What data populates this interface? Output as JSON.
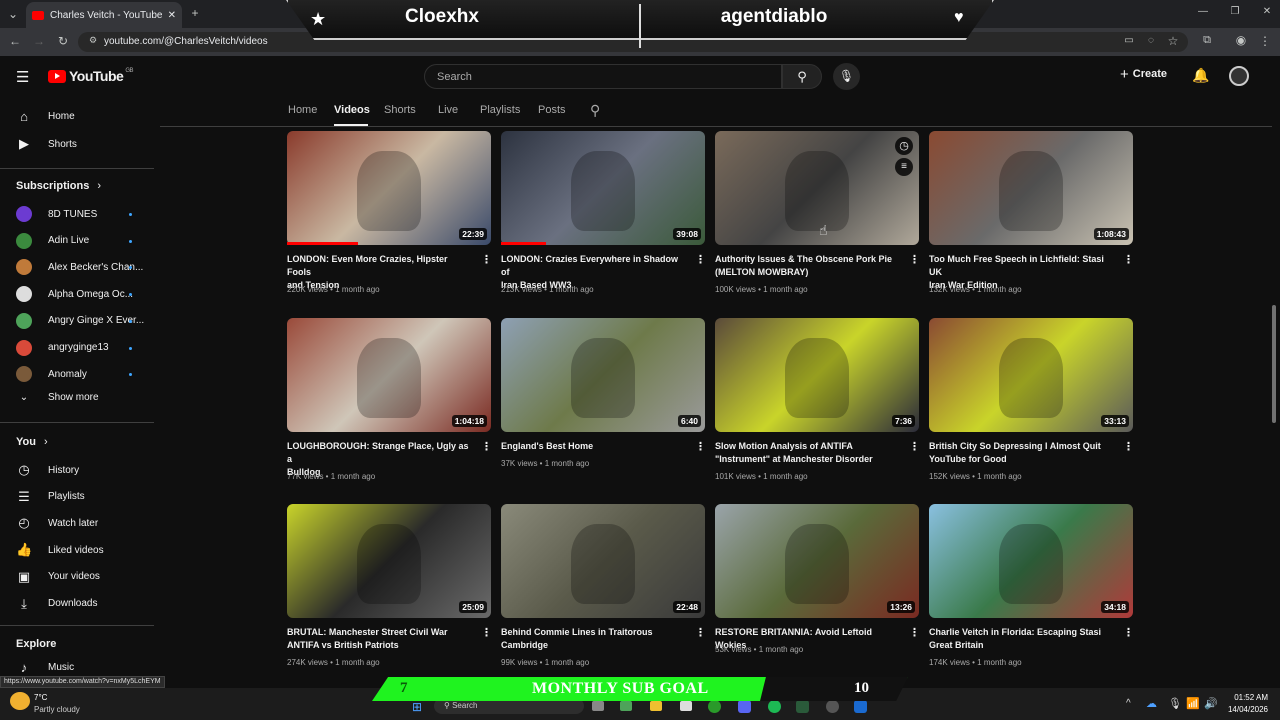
{
  "browser": {
    "tab_title": "Charles Veitch - YouTube",
    "url": "youtube.com/@CharlesVeitch/videos",
    "status_url": "https://www.youtube.com/watch?v=nxMy5LchEYM"
  },
  "overlay": {
    "left_name": "Cloexhx",
    "right_name": "agentdiablo",
    "goal_label": "MONTHLY SUB GOAL",
    "goal_current": "7",
    "goal_target": "10"
  },
  "header": {
    "logo_text": "YouTube",
    "region": "GB",
    "search_placeholder": "Search",
    "create_label": "Create"
  },
  "sidebar": {
    "top": [
      {
        "label": "Home",
        "icon": "home-icon"
      },
      {
        "label": "Shorts",
        "icon": "shorts-icon"
      }
    ],
    "subscriptions_title": "Subscriptions",
    "subscriptions": [
      {
        "label": "8D TUNES",
        "color": "#6c3bd1"
      },
      {
        "label": "Adin Live",
        "color": "#3b8a3e"
      },
      {
        "label": "Alex Becker's Chan...",
        "color": "#c07a3a"
      },
      {
        "label": "Alpha Omega Oc...",
        "color": "#dddddd"
      },
      {
        "label": "Angry Ginge X Ever...",
        "color": "#4ea35a"
      },
      {
        "label": "angryginge13",
        "color": "#d94a3a"
      },
      {
        "label": "Anomaly",
        "color": "#7a5a3a"
      }
    ],
    "show_more": "Show more",
    "you_title": "You",
    "you_items": [
      {
        "label": "History",
        "icon": "history-icon"
      },
      {
        "label": "Playlists",
        "icon": "playlists-icon"
      },
      {
        "label": "Watch later",
        "icon": "watch-later-icon"
      },
      {
        "label": "Liked videos",
        "icon": "liked-videos-icon"
      },
      {
        "label": "Your videos",
        "icon": "your-videos-icon"
      },
      {
        "label": "Downloads",
        "icon": "downloads-icon"
      }
    ],
    "explore_title": "Explore",
    "explore_items": [
      {
        "label": "Music",
        "icon": "music-icon"
      }
    ]
  },
  "channel_tabs": [
    "Home",
    "Videos",
    "Shorts",
    "Live",
    "Playlists",
    "Posts"
  ],
  "active_tab": "Videos",
  "videos": [
    {
      "title_1": "LONDON: Even More Crazies, Hipster Fools",
      "title_2": "and Tension",
      "meta": "220K views • 1 month ago",
      "duration": "22:39",
      "watched": 0.35,
      "colors": [
        "#8a3b2c",
        "#c9b8a2",
        "#3a4a6a"
      ]
    },
    {
      "title_1": "LONDON: Crazies Everywhere in Shadow of",
      "title_2": "Iran Based WW3",
      "meta": "213K views • 1 month ago",
      "duration": "39:08",
      "watched": 0.22,
      "colors": [
        "#2d3340",
        "#6a7080",
        "#3b5a3a"
      ]
    },
    {
      "title_1": "Authority Issues & The Obscene Pork Pie",
      "title_2": "(MELTON MOWBRAY)",
      "meta": "100K views • 1 month ago",
      "duration": "",
      "watched": 0,
      "colors": [
        "#7a6a5a",
        "#444444",
        "#b0a89a"
      ]
    },
    {
      "title_1": "Too Much Free Speech in Lichfield: Stasi UK",
      "title_2": "Iran War Edition",
      "meta": "132K views • 1 month ago",
      "duration": "1:08:43",
      "watched": 0,
      "colors": [
        "#8a4a32",
        "#6a6a6a",
        "#c9c2b2"
      ]
    },
    {
      "title_1": "LOUGHBOROUGH: Strange Place, Ugly as a",
      "title_2": "Bulldog",
      "meta": "77K views • 1 month ago",
      "duration": "1:04:18",
      "watched": 0,
      "colors": [
        "#9a4a3a",
        "#cfc6b8",
        "#7a2a22"
      ]
    },
    {
      "title_1": "England's Best Home",
      "title_2": "",
      "meta": "37K views • 1 month ago",
      "duration": "6:40",
      "watched": 0,
      "colors": [
        "#8ea0b4",
        "#6e7a4a",
        "#9a9a9a"
      ]
    },
    {
      "title_1": "Slow Motion Analysis of ANTIFA",
      "title_2": "\"Instrument\" at Manchester Disorder",
      "meta": "101K views • 1 month ago",
      "duration": "7:36",
      "watched": 0,
      "colors": [
        "#5a4a3a",
        "#c9d42a",
        "#2a2a3a"
      ]
    },
    {
      "title_1": "British City So Depressing I Almost Quit",
      "title_2": "YouTube for Good",
      "meta": "152K views • 1 month ago",
      "duration": "33:13",
      "watched": 0,
      "colors": [
        "#8a4a32",
        "#c9d42a",
        "#5a5a5a"
      ]
    },
    {
      "title_1": "BRUTAL: Manchester Street Civil War",
      "title_2": "ANTIFA vs British Patriots",
      "meta": "274K views • 1 month ago",
      "duration": "25:09",
      "watched": 0,
      "colors": [
        "#c9d42a",
        "#2a2a2a",
        "#6a6a6a"
      ]
    },
    {
      "title_1": "Behind Commie Lines in Traitorous",
      "title_2": "Cambridge",
      "meta": "99K views • 1 month ago",
      "duration": "22:48",
      "watched": 0,
      "colors": [
        "#8a8a7a",
        "#5a5a4a",
        "#3a3a3a"
      ]
    },
    {
      "title_1": "RESTORE BRITANNIA: Avoid Leftoid Wokies",
      "title_2": "",
      "meta": "53K views • 1 month ago",
      "duration": "13:26",
      "watched": 0,
      "colors": [
        "#9aa4aa",
        "#5a6a3a",
        "#7a2a22"
      ]
    },
    {
      "title_1": "Charlie Veitch in Florida: Escaping Stasi",
      "title_2": "Great Britain",
      "meta": "174K views • 1 month ago",
      "duration": "34:18",
      "watched": 0,
      "colors": [
        "#8ac0e0",
        "#3a7a4a",
        "#b03a3a"
      ]
    }
  ],
  "taskbar": {
    "weather_temp": "7°C",
    "weather_desc": "Partly cloudy",
    "search_label": "Search",
    "time": "01:52 AM",
    "date": "14/04/2026"
  }
}
